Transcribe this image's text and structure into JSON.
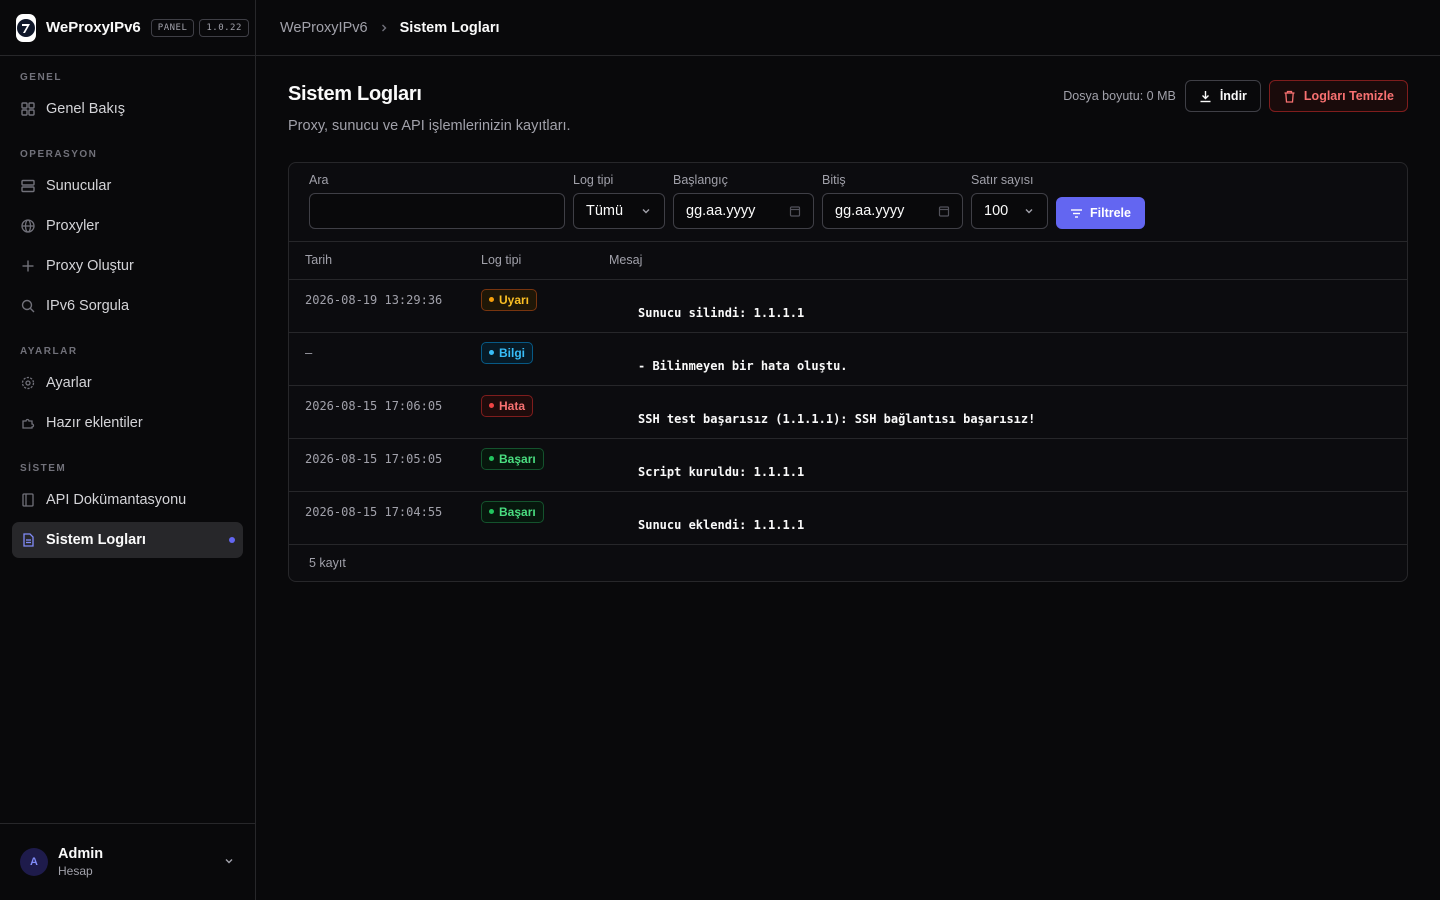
{
  "brand": {
    "name": "WeProxyIPv6",
    "panel_chip": "PANEL",
    "version": "1.0.22"
  },
  "sidebar": {
    "sections": [
      {
        "label": "GENEL",
        "items": [
          {
            "label": "Genel Bakış",
            "icon": "grid-icon"
          }
        ]
      },
      {
        "label": "OPERASYON",
        "items": [
          {
            "label": "Sunucular",
            "icon": "server-icon"
          },
          {
            "label": "Proxyler",
            "icon": "globe-icon"
          },
          {
            "label": "Proxy Oluştur",
            "icon": "plus-icon"
          },
          {
            "label": "IPv6 Sorgula",
            "icon": "search-icon"
          }
        ]
      },
      {
        "label": "AYARLAR",
        "items": [
          {
            "label": "Ayarlar",
            "icon": "gear-icon"
          },
          {
            "label": "Hazır eklentiler",
            "icon": "puzzle-icon"
          }
        ]
      },
      {
        "label": "SİSTEM",
        "items": [
          {
            "label": "API Dokümantasyonu",
            "icon": "book-icon"
          },
          {
            "label": "Sistem Logları",
            "icon": "file-text-icon",
            "active": true
          }
        ]
      }
    ],
    "user": {
      "initial": "A",
      "name": "Admin",
      "role": "Hesap"
    }
  },
  "breadcrumb": {
    "root": "WeProxyIPv6",
    "current": "Sistem Logları"
  },
  "page": {
    "title": "Sistem Logları",
    "subtitle": "Proxy, sunucu ve API işlemlerinizin kayıtları.",
    "file_size": "Dosya boyutu: 0 MB",
    "download_label": "İndir",
    "clear_label": "Logları Temizle"
  },
  "filters": {
    "search_label": "Ara",
    "search_value": "",
    "type_label": "Log tipi",
    "type_value": "Tümü",
    "start_label": "Başlangıç",
    "start_placeholder": "gg.aa.yyyy",
    "end_label": "Bitiş",
    "end_placeholder": "gg.aa.yyyy",
    "rows_label": "Satır sayısı",
    "rows_value": "100",
    "filter_button": "Filtrele"
  },
  "table": {
    "columns": [
      "Tarih",
      "Log tipi",
      "Mesaj"
    ],
    "rows": [
      {
        "date": "2026-08-19 13:29:36",
        "type": "Uyarı",
        "kind": "warning",
        "message": "Sunucu silindi: 1.1.1.1"
      },
      {
        "date": "—",
        "type": "Bilgi",
        "kind": "info",
        "message": "- Bilinmeyen bir hata oluştu."
      },
      {
        "date": "2026-08-15 17:06:05",
        "type": "Hata",
        "kind": "error",
        "message": "SSH test başarısız (1.1.1.1): SSH bağlantısı başarısız!"
      },
      {
        "date": "2026-08-15 17:05:05",
        "type": "Başarı",
        "kind": "success",
        "message": "Script kuruldu: 1.1.1.1"
      },
      {
        "date": "2026-08-15 17:04:55",
        "type": "Başarı",
        "kind": "success",
        "message": "Sunucu eklendi: 1.1.1.1"
      }
    ],
    "footer": "5 kayıt"
  },
  "colors": {
    "accent": "#6366f1",
    "warning": "#f59e0b",
    "info": "#38bdf8",
    "error": "#ef4444",
    "success": "#22c55e",
    "danger_text": "#f87171"
  }
}
